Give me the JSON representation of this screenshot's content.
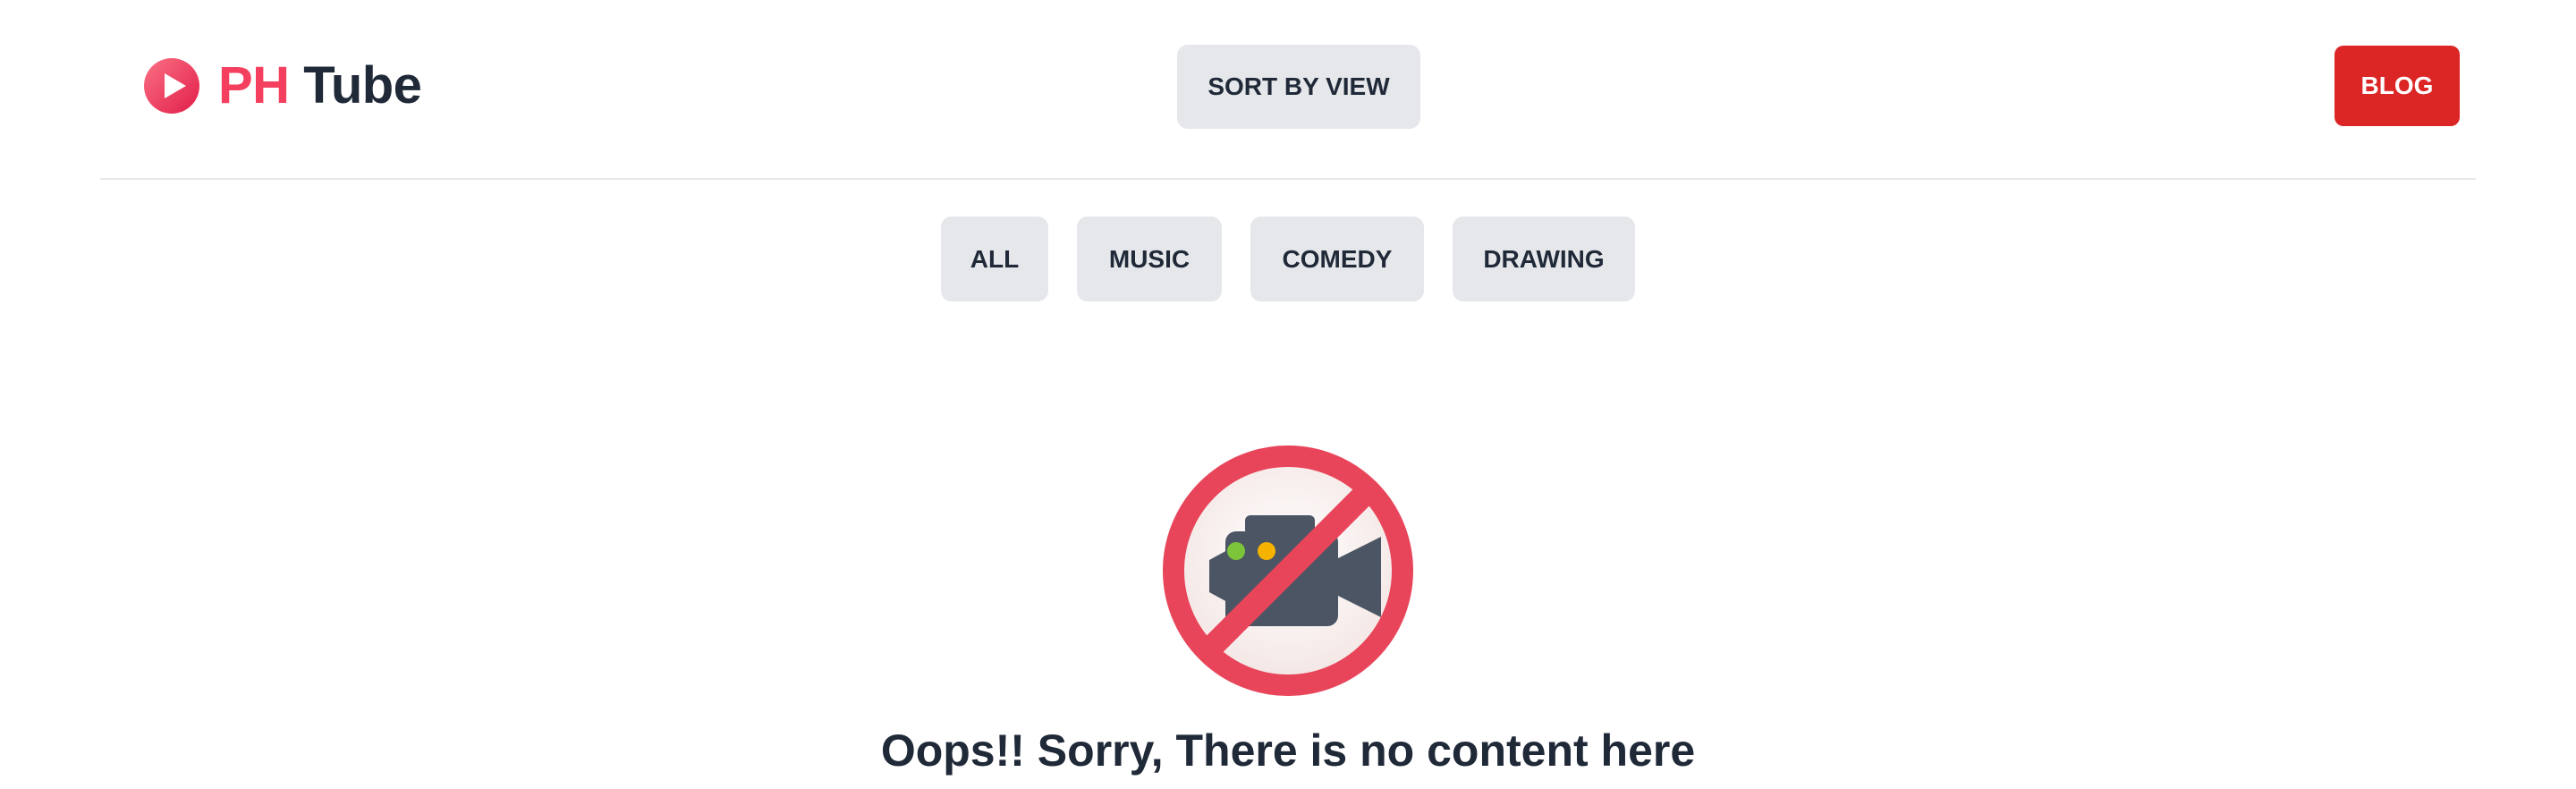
{
  "header": {
    "logo_ph": "PH",
    "logo_tube": "Tube",
    "logo_icon": "play-circle-icon",
    "sort_label": "SORT BY VIEW",
    "blog_label": "BLOG"
  },
  "categories": [
    "ALL",
    "MUSIC",
    "COMEDY",
    "DRAWING"
  ],
  "empty_state": {
    "icon": "no-video-camera-icon",
    "message": "Oops!! Sorry, There is no content here"
  },
  "colors": {
    "brand": "#f43f5e",
    "blog_button": "#dc2626",
    "button_bg": "#e5e7eb",
    "text": "#1f2937"
  }
}
